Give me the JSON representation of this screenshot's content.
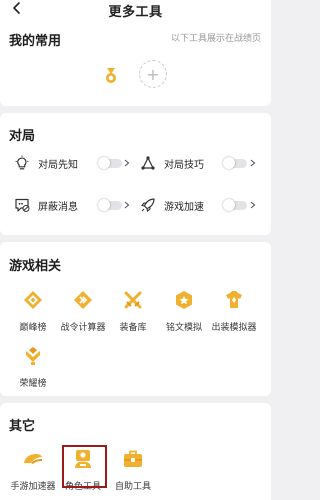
{
  "header": {
    "title": "更多工具"
  },
  "favorites": {
    "title": "我的常用",
    "hint": "以下工具展示在战绩页",
    "add_symbol": "+"
  },
  "duel": {
    "title": "对局",
    "items": [
      {
        "label": "对局先知",
        "icon": "bulb-icon",
        "state": "off"
      },
      {
        "label": "对局技巧",
        "icon": "triangle-nodes-icon",
        "state": "off"
      },
      {
        "label": "屏蔽消息",
        "icon": "chat-block-icon",
        "state": "off"
      },
      {
        "label": "游戏加速",
        "icon": "rocket-icon",
        "state": "off"
      }
    ]
  },
  "game": {
    "title": "游戏相关",
    "tools": [
      {
        "label": "巅峰榜",
        "icon": "peak-rank-icon"
      },
      {
        "label": "战令计算器",
        "icon": "battle-pass-icon"
      },
      {
        "label": "装备库",
        "icon": "crossed-swords-icon"
      },
      {
        "label": "铭文模拟",
        "icon": "inscription-icon"
      },
      {
        "label": "出装模拟器",
        "icon": "outfit-icon"
      },
      {
        "label": "荣耀榜",
        "icon": "glory-rank-icon"
      }
    ]
  },
  "other": {
    "title": "其它",
    "tools": [
      {
        "label": "手游加速器",
        "icon": "speed-icon"
      },
      {
        "label": "角色工具",
        "icon": "role-tool-icon"
      },
      {
        "label": "自助工具",
        "icon": "toolbox-icon"
      }
    ]
  },
  "colors": {
    "accent": "#f0b030",
    "accent_dark": "#e59a1c",
    "background": "#f0f0f2",
    "highlight": "#9b1b1b"
  }
}
